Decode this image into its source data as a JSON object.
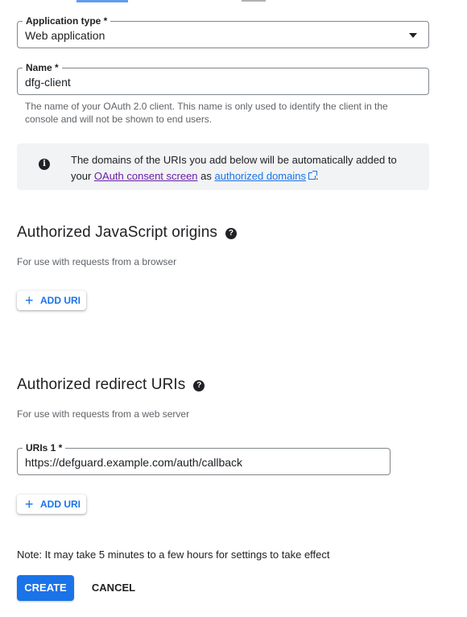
{
  "app_type": {
    "label": "Application type *",
    "value": "Web application"
  },
  "name": {
    "label": "Name *",
    "value": "dfg-client",
    "hint": "The name of your OAuth 2.0 client. This name is only used to identify the client in the console and will not be shown to end users."
  },
  "info": {
    "text_before": "The domains of the URIs you add below will be automatically added to your ",
    "link1": "OAuth consent screen",
    "text_mid": " as ",
    "link2": "authorized domains",
    "text_after": "."
  },
  "js_origins": {
    "heading": "Authorized JavaScript origins",
    "sub": "For use with requests from a browser",
    "add_label": "ADD URI"
  },
  "redirect_uris": {
    "heading": "Authorized redirect URIs",
    "sub": "For use with requests from a web server",
    "field_label": "URIs 1 *",
    "field_value": "https://defguard.example.com/auth/callback",
    "add_label": "ADD URI"
  },
  "note": "Note: It may take 5 minutes to a few hours for settings to take effect",
  "actions": {
    "create": "CREATE",
    "cancel": "CANCEL"
  },
  "icons": {
    "info": "info-icon",
    "help": "help-icon",
    "plus": "plus-icon",
    "dropdown": "dropdown-caret-icon",
    "external": "external-link-icon"
  },
  "colors": {
    "accent": "#1a73e8",
    "visited_link": "#681da8",
    "info_bg": "#f1f3f4"
  }
}
